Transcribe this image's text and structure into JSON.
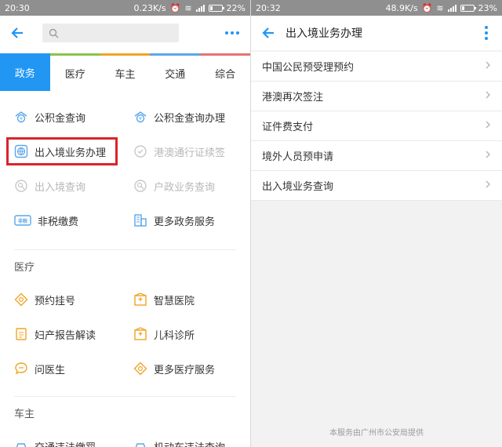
{
  "left": {
    "status": {
      "time": "20:30",
      "speed": "0.23K/s",
      "battery": "22%",
      "battery_level": 0.22
    },
    "tabs": [
      "政务",
      "医疗",
      "车主",
      "交通",
      "综合"
    ],
    "active_tab": 0,
    "gov_items": [
      {
        "label": "公积金查询",
        "icon": "fund-icon",
        "enabled": true
      },
      {
        "label": "公积金查询办理",
        "icon": "fund-icon",
        "enabled": true
      },
      {
        "label": "出入境业务办理",
        "icon": "globe-icon",
        "enabled": true,
        "highlighted": true
      },
      {
        "label": "港澳通行证续签",
        "icon": "pass-icon",
        "enabled": false
      },
      {
        "label": "出入境查询",
        "icon": "search-icon",
        "enabled": false
      },
      {
        "label": "户政业务查询",
        "icon": "search-icon",
        "enabled": false
      },
      {
        "label": "非税缴费",
        "icon": "tax-icon",
        "enabled": true
      },
      {
        "label": "更多政务服务",
        "icon": "building-icon",
        "enabled": true
      }
    ],
    "medical_title": "医疗",
    "medical_items": [
      {
        "label": "预约挂号",
        "icon": "diamond-icon"
      },
      {
        "label": "智慧医院",
        "icon": "hospital-icon"
      },
      {
        "label": "妇产报告解读",
        "icon": "report-icon"
      },
      {
        "label": "儿科诊所",
        "icon": "hospital-icon"
      },
      {
        "label": "问医生",
        "icon": "chat-icon"
      },
      {
        "label": "更多医疗服务",
        "icon": "diamond-icon"
      }
    ],
    "car_title": "车主",
    "car_items": [
      {
        "label": "交通违法缴罚",
        "icon": "car-icon"
      },
      {
        "label": "机动车违法查询",
        "icon": "car-icon"
      }
    ]
  },
  "right": {
    "status": {
      "time": "20:32",
      "speed": "48.9K/s",
      "battery": "23%",
      "battery_level": 0.23
    },
    "title": "出入境业务办理",
    "items": [
      "中国公民预受理预约",
      "港澳再次签注",
      "证件费支付",
      "境外人员预申请",
      "出入境业务查询"
    ],
    "footer": "本服务由广州市公安局提供"
  },
  "colors": {
    "accent": "#2196f3",
    "highlight": "#d9242a",
    "icon": "#5aa6ea",
    "icon_orange": "#f0a424"
  }
}
